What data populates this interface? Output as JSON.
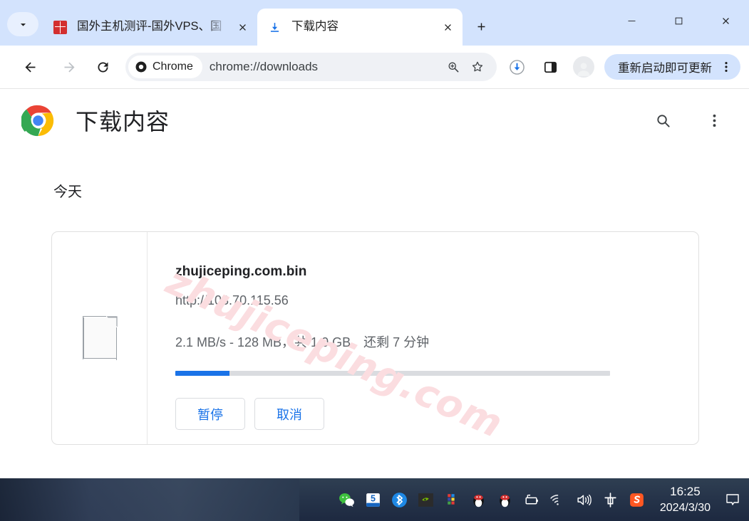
{
  "window": {
    "controls": {
      "minimize": "minimize",
      "maximize": "maximize",
      "close": "close"
    }
  },
  "tabs": {
    "search_tab_tooltip": "Search tabs",
    "new_tab_label": "New tab",
    "items": [
      {
        "title": "国外主机测评-国外VPS、国",
        "favicon": "seal-favicon",
        "active": false
      },
      {
        "title": "下载内容",
        "favicon": "download-icon",
        "active": true
      }
    ]
  },
  "toolbar": {
    "back": "back-arrow-icon",
    "forward": "forward-arrow-icon",
    "reload": "reload-icon",
    "omnibox": {
      "chip_label": "Chrome",
      "url": "chrome://downloads",
      "zoom_icon": "zoom-in-icon",
      "bookmark_icon": "star-icon"
    },
    "downloads_icon": "downloads-progress-icon",
    "side_panel_icon": "side-panel-icon",
    "profile_icon": "avatar-icon",
    "update_label": "重新启动即可更新",
    "menu_icon": "three-dot-menu-icon"
  },
  "downloads_page": {
    "logo": "chrome-logo",
    "title": "下载内容",
    "search_icon": "search-icon",
    "menu_icon": "three-dot-menu-icon",
    "section_label": "今天",
    "item": {
      "file_icon": "document-icon",
      "filename": "zhujiceping.com.bin",
      "url": "http://103.70.115.56",
      "status": "2.1 MB/s - 128 MB，共 1.0 GB，还剩 7 分钟",
      "progress_percent": 12.5,
      "progress_fill_color": "#1a73e8",
      "progress_track_color": "#dadce0",
      "pause_label": "暂停",
      "cancel_label": "取消"
    },
    "watermark": "zhujiceping.com"
  },
  "taskbar": {
    "tray": [
      {
        "name": "wechat-icon"
      },
      {
        "name": "xunlei-icon"
      },
      {
        "name": "bluetooth-icon"
      },
      {
        "name": "nvidia-icon"
      },
      {
        "name": "color-grid-icon"
      },
      {
        "name": "qq-icon"
      },
      {
        "name": "qq-icon-2"
      },
      {
        "name": "battery-charging-icon"
      },
      {
        "name": "wifi-icon"
      },
      {
        "name": "volume-icon"
      },
      {
        "name": "ime-chinese-icon",
        "label": "中"
      },
      {
        "name": "sogou-icon",
        "label": "S"
      }
    ],
    "clock": {
      "time": "16:25",
      "date": "2024/3/30"
    },
    "notification_icon": "notification-icon"
  }
}
